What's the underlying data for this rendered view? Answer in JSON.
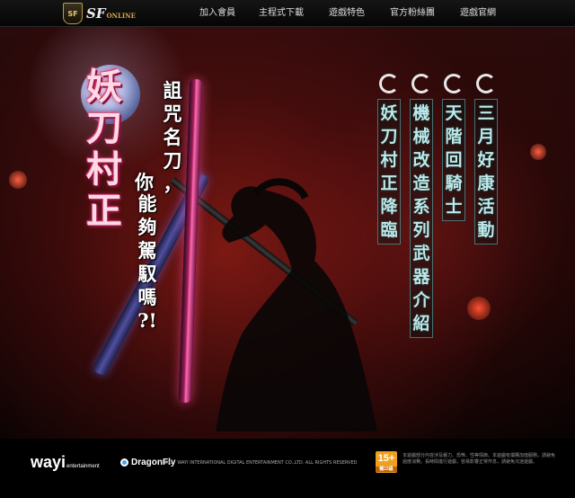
{
  "header": {
    "logo_badge": "SF",
    "logo_text": "SF",
    "logo_suffix": "ONLINE",
    "nav": [
      {
        "label": "加入會員"
      },
      {
        "label": "主程式下載"
      },
      {
        "label": "遊戲特色"
      },
      {
        "label": "官方粉絲團"
      },
      {
        "label": "遊戲官網"
      }
    ]
  },
  "hero": {
    "title": [
      "妖",
      "刀",
      "村",
      "正"
    ],
    "subtitle_col1": [
      "詛",
      "咒",
      "名",
      "刀",
      "，"
    ],
    "subtitle_col2": [
      "你",
      "能",
      "夠",
      "駕",
      "馭",
      "嗎",
      "?!"
    ]
  },
  "menu": [
    {
      "chars": [
        "三",
        "月",
        "好",
        "康",
        "活",
        "動"
      ]
    },
    {
      "chars": [
        "天",
        "階",
        "回",
        "騎",
        "士"
      ]
    },
    {
      "chars": [
        "機",
        "械",
        "改",
        "造",
        "系",
        "列",
        "武",
        "器",
        "介",
        "紹"
      ]
    },
    {
      "chars": [
        "妖",
        "刀",
        "村",
        "正",
        "降",
        "臨"
      ]
    }
  ],
  "footer": {
    "wayi": "wayi",
    "wayi_suffix": "entertainment",
    "dragonfly": "DragonFly",
    "copyright": "©2017 WAYI INTERNATIONAL DIGITAL ENTERTAINMENT CO.,LTD. ALL RIGHTS RESERVED",
    "rating": "15+",
    "rating_label": "輔15級",
    "notice": "本遊戲部分內容涉及暴力、恐怖、性等情節。本遊戲有償購加值服務，請避免過度消費。長時間進行遊戲，容易影響正常作息，請避免沉迷遊戲。"
  },
  "colors": {
    "accent": "#c0205a",
    "menu_text": "#bfe8e8",
    "rating": "#f0a020"
  }
}
